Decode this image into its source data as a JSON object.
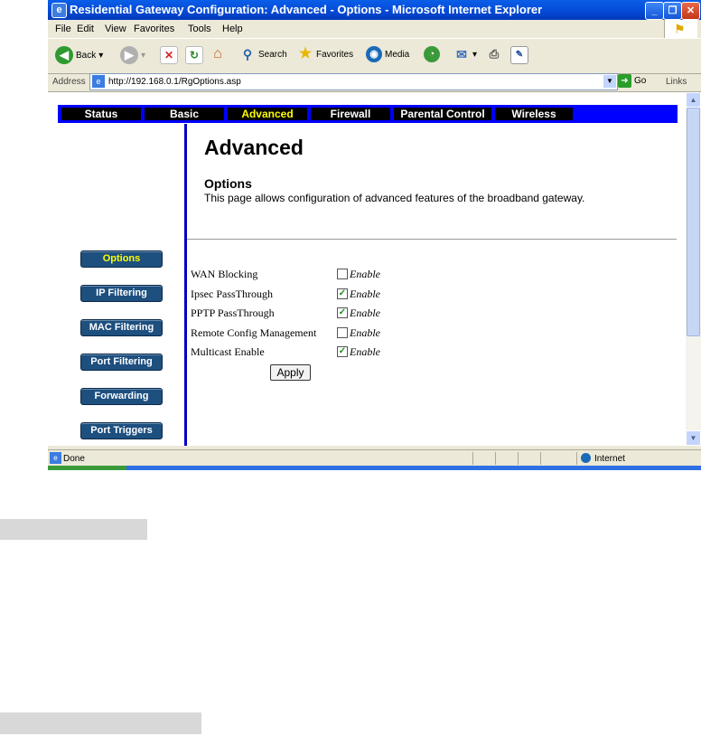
{
  "window": {
    "title": "Residential Gateway Configuration: Advanced - Options - Microsoft Internet Explorer",
    "minimize": "_",
    "maximize": "❐",
    "close": "✕"
  },
  "menu": [
    "File",
    "Edit",
    "View",
    "Favorites",
    "Tools",
    "Help"
  ],
  "toolbar": {
    "back": "Back",
    "search": "Search",
    "favorites": "Favorites",
    "media": "Media"
  },
  "address": {
    "label": "Address",
    "url": "http://192.168.0.1/RgOptions.asp",
    "go": "Go",
    "links": "Links"
  },
  "nav": {
    "tabs": [
      "Status",
      "Basic",
      "Advanced",
      "Firewall",
      "Parental Control",
      "Wireless"
    ],
    "active": "Advanced"
  },
  "page": {
    "heading": "Advanced",
    "section": "Options",
    "description": "This page allows configuration of advanced features of the broadband gateway."
  },
  "sidebar": {
    "items": [
      "Options",
      "IP Filtering",
      "MAC Filtering",
      "Port Filtering",
      "Forwarding",
      "Port Triggers"
    ],
    "active": "Options"
  },
  "options": [
    {
      "label": "WAN Blocking",
      "checked": false,
      "suffix": "Enable"
    },
    {
      "label": "Ipsec PassThrough",
      "checked": true,
      "suffix": "Enable"
    },
    {
      "label": "PPTP PassThrough",
      "checked": true,
      "suffix": "Enable"
    },
    {
      "label": "Remote Config Management",
      "checked": false,
      "suffix": "Enable"
    },
    {
      "label": "Multicast Enable",
      "checked": true,
      "suffix": "Enable"
    }
  ],
  "apply_label": "Apply",
  "status": {
    "text": "Done",
    "zone": "Internet"
  },
  "colors": {
    "nav_bg": "#0000ff",
    "active_tab": "#ffff00",
    "sidebar_button": "#1d4f7f"
  }
}
